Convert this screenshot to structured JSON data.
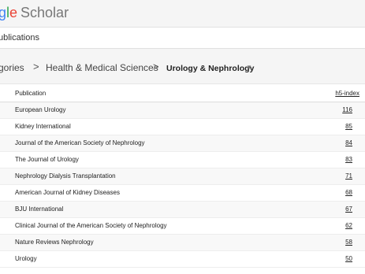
{
  "header": {
    "logo_part1": "g",
    "logo_part2": "l",
    "logo_part3": "e",
    "logo_product": "Scholar"
  },
  "subbar": {
    "label": "ublications"
  },
  "breadcrumb": {
    "items": [
      "gories",
      "Health & Medical Sciences",
      "Urology & Nephrology"
    ],
    "separator": ">"
  },
  "table": {
    "columns": [
      "Publication",
      "h5-index"
    ],
    "rows": [
      {
        "name": "European Urology",
        "h5": "116"
      },
      {
        "name": "Kidney International",
        "h5": "85"
      },
      {
        "name": "Journal of the American Society of Nephrology",
        "h5": "84"
      },
      {
        "name": "The Journal of Urology",
        "h5": "83"
      },
      {
        "name": "Nephrology Dialysis Transplantation",
        "h5": "71"
      },
      {
        "name": "American Journal of Kidney Diseases",
        "h5": "68"
      },
      {
        "name": "BJU International",
        "h5": "67"
      },
      {
        "name": "Clinical Journal of the American Society of Nephrology",
        "h5": "62"
      },
      {
        "name": "Nature Reviews Nephrology",
        "h5": "58"
      },
      {
        "name": "Urology",
        "h5": "50"
      }
    ]
  },
  "icons": {
    "dropdown": "caret-down-icon"
  }
}
